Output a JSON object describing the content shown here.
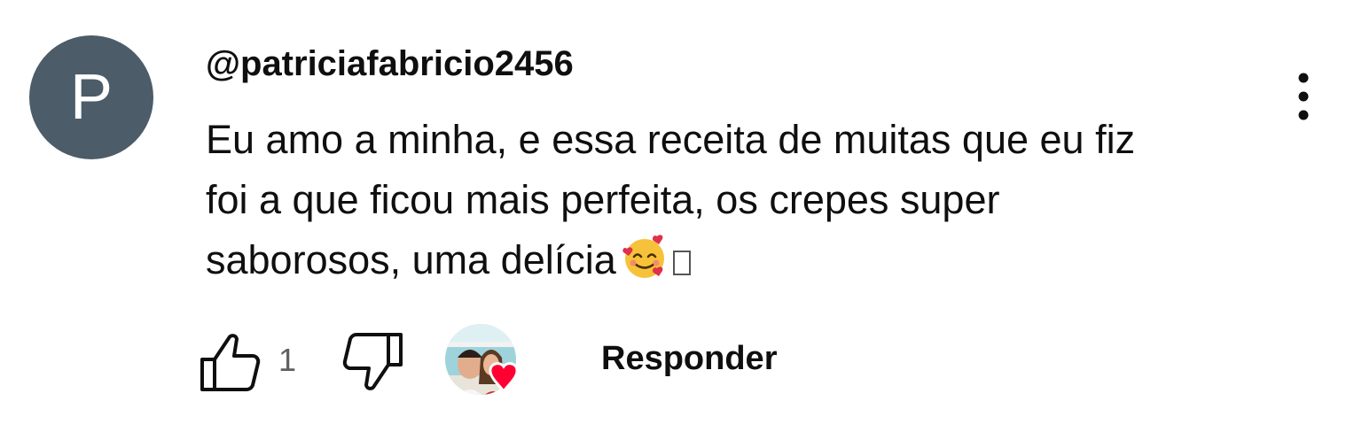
{
  "comment": {
    "avatar_letter": "P",
    "avatar_color": "#4c5c68",
    "author": "@patriciafabricio2456",
    "text_lines": [
      "Eu amo a minha, e essa receita de muitas que eu fiz",
      "foi a que ficou mais perfeita, os crepes super",
      "saborosos, uma delícia"
    ],
    "emoji": "smiling-face-with-hearts-icon",
    "actions": {
      "like_count": "1",
      "reply_label": "Responder",
      "creator_heart_color": "#ff0033"
    }
  }
}
